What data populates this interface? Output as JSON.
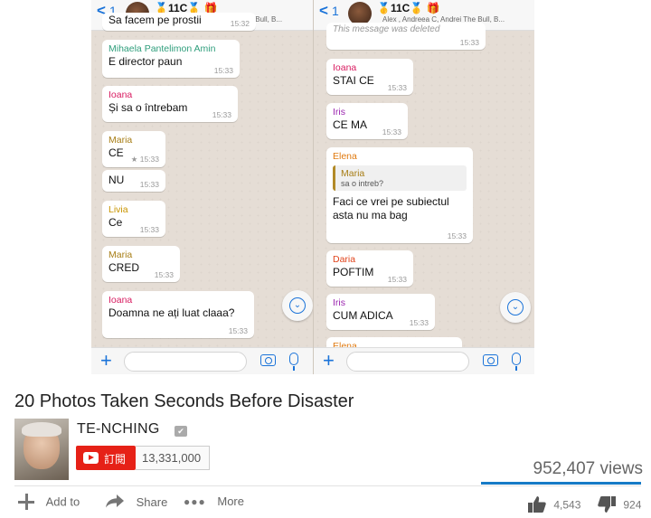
{
  "thumbnail": {
    "left": {
      "header": {
        "back_arrow": "<",
        "back_count": "1",
        "group": "🥇11C🥇 🎁",
        "members": "Alex , Andreea C, Andrei The Bull, B..."
      },
      "messages": [
        {
          "sender": "",
          "text": "Sa facem pe prostii",
          "time": "15:32"
        },
        {
          "sender": "Mihaela Pantelimon Amin",
          "text": "E director paun",
          "time": "15:33"
        },
        {
          "sender": "Ioana",
          "text": "Și sa o întrebam",
          "time": "15:33"
        },
        {
          "sender": "Maria",
          "text": "CE",
          "time": "★ 15:33"
        },
        {
          "sender": "",
          "text": "NU",
          "time": "15:33"
        },
        {
          "sender": "Livia",
          "text": "Ce",
          "time": "15:33"
        },
        {
          "sender": "Maria",
          "text": "CRED",
          "time": "15:33"
        },
        {
          "sender": "Ioana",
          "text": "Doamna ne ați luat claaa?",
          "time": "15:33"
        }
      ]
    },
    "right": {
      "header": {
        "back_arrow": "<",
        "back_count": "1",
        "group": "🥇11C🥇 🎁",
        "members": "Alex , Andreea C, Andrei The Bull, B..."
      },
      "messages": [
        {
          "sender": "",
          "text": "This message was deleted",
          "time": "15:33"
        },
        {
          "sender": "Ioana",
          "text": "STAI CE",
          "time": "15:33"
        },
        {
          "sender": "Iris",
          "text": "CE MA",
          "time": "15:33"
        },
        {
          "sender": "Elena",
          "quote_sender": "Maria",
          "quote_text": "sa o intreb?",
          "text": "Faci ce vrei pe subiectul",
          "text2": "asta nu ma bag",
          "time": "15:33"
        },
        {
          "sender": "Daria",
          "text": "POFTIM",
          "time": "15:33"
        },
        {
          "sender": "Iris",
          "text": "CUM ADICA",
          "time": "15:33"
        },
        {
          "sender": "Elena",
          "text": "",
          "time": ""
        }
      ]
    },
    "colors": {
      "ioana": "#d81b60",
      "maria": "#a77d15",
      "mihaela": "#2f9e7c",
      "livia": "#c99400",
      "iris": "#9c27b0",
      "elena": "#e07a10",
      "daria": "#e0431b",
      "accent": "#1a73d9"
    }
  },
  "video": {
    "title": "20 Photos Taken Seconds Before Disaster",
    "channel": "TE-NCHING",
    "verified_mark": "✔",
    "subscribe_label": "訂閱",
    "subscriber_count": "13,331,000",
    "views": "952,407 views",
    "actions": {
      "add_to": "Add to",
      "share": "Share",
      "more": "More"
    },
    "likes": "4,543",
    "dislikes": "924"
  }
}
